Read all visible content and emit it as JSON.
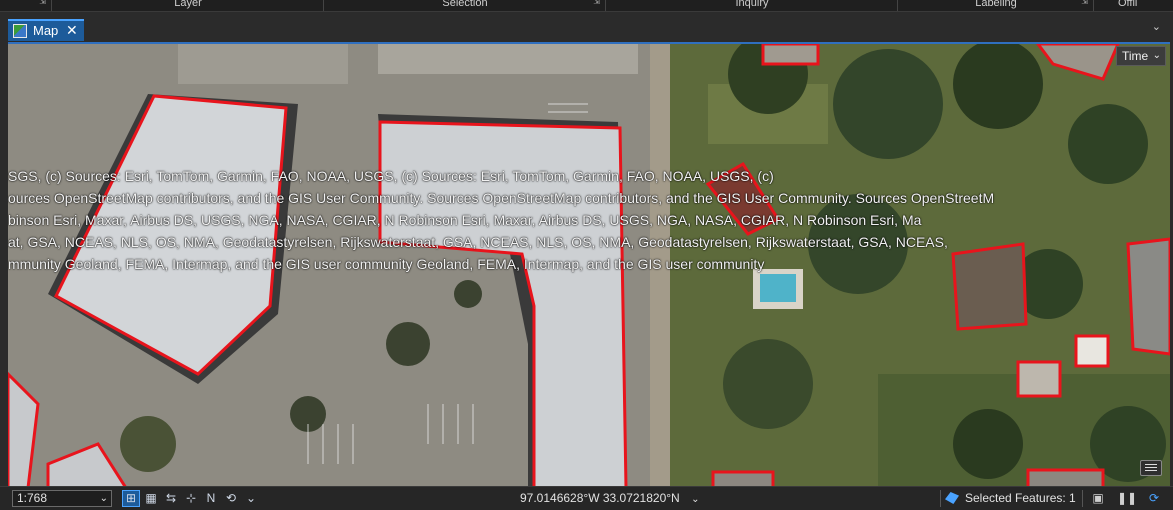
{
  "ribbon": {
    "groups": [
      {
        "label": "",
        "launcher": "⇲"
      },
      {
        "label": "Layer",
        "launcher": ""
      },
      {
        "label": "Selection",
        "launcher": "⇲"
      },
      {
        "label": "Inquiry",
        "launcher": ""
      },
      {
        "label": "Labeling",
        "launcher": "⇲"
      },
      {
        "label": "Offli",
        "launcher": ""
      }
    ]
  },
  "tab": {
    "label": "Map",
    "close": "✕",
    "icon": "map-icon",
    "overflow": "⌄"
  },
  "map": {
    "time_button": "Time",
    "attribution": [
      "SGS, (c)              Sources:  Esri, TomTom, Garmin, FAO, NOAA, USGS, (c)                                    Sources:  Esri, TomTom, Garmin, FAO, NOAA, USGS, (c)",
      "ources OpenStreetMap contributors, and the GIS User Community. Sources OpenStreetMap contributors, and the GIS User Community. Sources OpenStreetM",
      "binson          Esri, Maxar, Airbus DS, USGS, NGA, NASA, CGIAR, N Robinson          Esri, Maxar, Airbus DS, USGS, NGA, NASA, CGIAR, N Robinson          Esri, Ma",
      "at, GSA,          NCEAS, NLS, OS, NMA, Geodatastyrelsen, Rijkswaterstaat, GSA,          NCEAS, NLS, OS, NMA, Geodatastyrelsen, Rijkswaterstaat, GSA,          NCEAS,",
      "mmunity                      Geoland, FEMA, Intermap, and the GIS user community                      Geoland, FEMA, Intermap, and the GIS user community"
    ],
    "colors": {
      "selection_outline": "#e8141c",
      "roof": "#cfd3d6",
      "parking": "#8f8c84",
      "lawn": "#5f6b3a",
      "trees": "#2f3f22"
    }
  },
  "status": {
    "scale": "1:768",
    "coordinates": "97.0146628°W 33.0721820°N",
    "selected_features": "Selected Features: 1",
    "tools": [
      "fixed-extent-icon",
      "grid-icon",
      "nav-icon",
      "snapping-icon",
      "north-icon",
      "correction-icon"
    ]
  }
}
